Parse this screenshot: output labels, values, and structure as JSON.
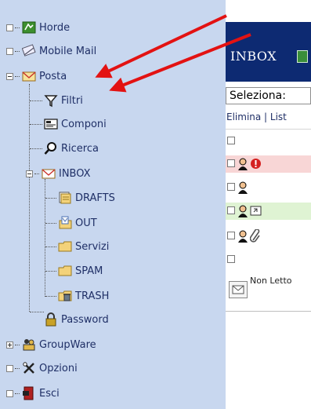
{
  "sidebar": {
    "items": {
      "horde": "Horde",
      "mobile_mail": "Mobile Mail",
      "posta": "Posta",
      "filtri": "Filtri",
      "componi": "Componi",
      "ricerca": "Ricerca",
      "inbox": "INBOX",
      "drafts": "DRAFTS",
      "out": "OUT",
      "servizi": "Servizi",
      "spam": "SPAM",
      "trash": "TRASH",
      "password": "Password",
      "groupware": "GroupWare",
      "opzioni": "Opzioni",
      "esci": "Esci"
    }
  },
  "main": {
    "title": "INBOX",
    "select_label": "Seleziona:",
    "actions_text": "Elimina | List",
    "legend_text": "Non Letto"
  },
  "annotations": {
    "arrow_color": "#e31212"
  },
  "colors": {
    "sidebar_bg": "#c8d7ef",
    "banner_bg": "#0d2a72",
    "row_flagged": "#f8d6d6",
    "row_answered": "#dff3d3"
  }
}
